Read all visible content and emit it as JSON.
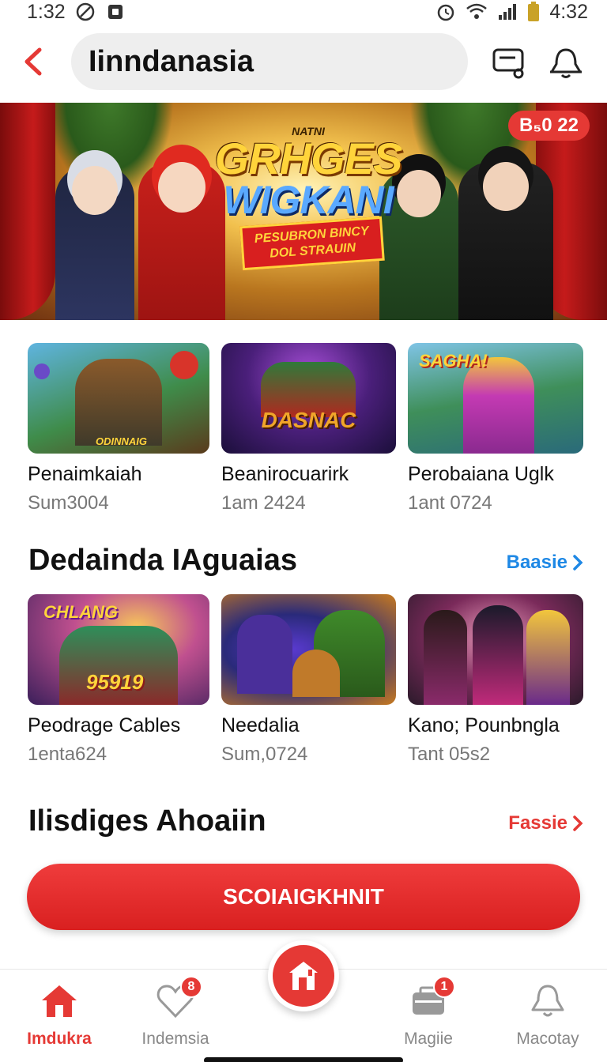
{
  "status_bar": {
    "time_left": "1:32",
    "time_right": "4:32"
  },
  "header": {
    "search_value": "Iinndanasia"
  },
  "hero": {
    "badge": "B₅0 22",
    "kicker": "NATNI",
    "title_line1": "GRHGES",
    "title_line2": "WIGKANI",
    "ribbon_line1": "PESUBRON BINCY",
    "ribbon_line2": "DOL STRAUIN"
  },
  "row1": [
    {
      "title": "Penaimkaiah",
      "subtitle": "Sum3004",
      "thumb_text": "ODINNAIG"
    },
    {
      "title": "Beanirocuarirk",
      "subtitle": "1am 2424",
      "thumb_text": "DASNAC"
    },
    {
      "title": "Perobaiana Uglk",
      "subtitle": "1ant 0724",
      "thumb_text": "SAGHA!"
    }
  ],
  "section1": {
    "title": "Dedainda IAguaias",
    "link": "Baasie"
  },
  "row2": [
    {
      "title": "Peodrage Cables",
      "subtitle": "1enta624",
      "thumb_text": "CHLANG",
      "thumb_num": "95919"
    },
    {
      "title": "Needalia",
      "subtitle": "Sum,0724",
      "thumb_text": ""
    },
    {
      "title": "Kano; Pounbngla",
      "subtitle": "Tant 05s2",
      "thumb_text": ""
    }
  ],
  "section2": {
    "title": "Ilisdiges Ahoaiin",
    "link": "Fassie"
  },
  "cta_label": "SCOIAIGKHNIT",
  "bottom_nav": {
    "items": [
      {
        "label": "Imdukra",
        "active": true
      },
      {
        "label": "Indemsia",
        "badge": "8"
      },
      {
        "label": "Magiie",
        "badge": "1"
      },
      {
        "label": "Macotay"
      }
    ]
  },
  "colors": {
    "accent": "#e53935",
    "link_blue": "#1e88e5"
  }
}
